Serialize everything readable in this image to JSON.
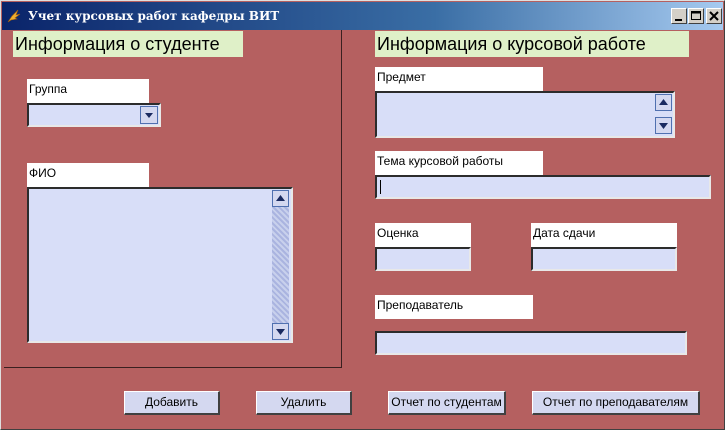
{
  "window": {
    "title": "Учет курсовых работ кафедры ВИТ"
  },
  "student": {
    "section_title": "Информация о студенте",
    "group_label": "Группа",
    "group_value": "",
    "fio_label": "ФИО"
  },
  "coursework": {
    "section_title": "Информация о курсовой работе",
    "subject_label": "Предмет",
    "topic_label": "Тема курсовой работы",
    "topic_value": "",
    "grade_label": "Оценка",
    "grade_value": "",
    "date_label": "Дата сдачи",
    "date_value": "",
    "teacher_label": "Преподаватель",
    "teacher_value": ""
  },
  "buttons": {
    "add": "Добавить",
    "delete": "Удалить",
    "report_students": "Отчет по студентам",
    "report_teachers": "Отчет по преподавателям"
  },
  "icons": {
    "app": "feather-icon",
    "minimize": "minimize-icon",
    "maximize": "maximize-icon",
    "close": "close-icon"
  },
  "colors": {
    "form_background": "#b56060",
    "section_header": "#dff0c8",
    "field_background": "#d8def8"
  }
}
